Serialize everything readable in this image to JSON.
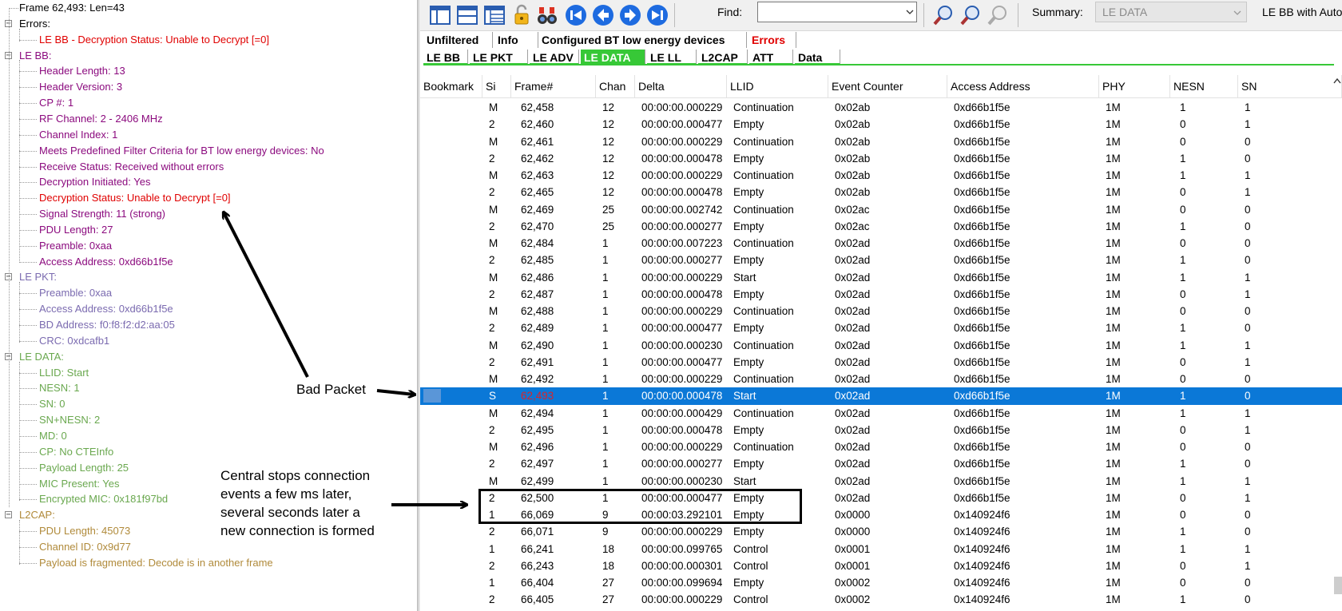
{
  "tree": {
    "rows": [
      {
        "text": "Frame 62,493:  Len=43",
        "color": "black",
        "indent": 0,
        "expander": "none"
      },
      {
        "text": "Errors:",
        "color": "black",
        "indent": 0,
        "expander": "minus"
      },
      {
        "text": "LE BB - Decryption Status: Unable to Decrypt [=0]",
        "color": "err",
        "indent": 1,
        "expander": "none"
      },
      {
        "text": "LE BB:",
        "color": "purple",
        "indent": 0,
        "expander": "minus"
      },
      {
        "text": "Header Length: 13",
        "color": "purple",
        "indent": 1,
        "expander": "none"
      },
      {
        "text": "Header Version: 3",
        "color": "purple",
        "indent": 1,
        "expander": "none"
      },
      {
        "text": "CP #: 1",
        "color": "purple",
        "indent": 1,
        "expander": "none"
      },
      {
        "text": "RF Channel:  2 - 2406 MHz",
        "color": "purple",
        "indent": 1,
        "expander": "none"
      },
      {
        "text": "Channel Index:  1",
        "color": "purple",
        "indent": 1,
        "expander": "none"
      },
      {
        "text": "Meets Predefined Filter Criteria for BT low energy devices: No",
        "color": "purple",
        "indent": 1,
        "expander": "none"
      },
      {
        "text": "Receive Status: Received without errors",
        "color": "purple",
        "indent": 1,
        "expander": "none"
      },
      {
        "text": "Decryption Initiated: Yes",
        "color": "purple",
        "indent": 1,
        "expander": "none"
      },
      {
        "text": "Decryption Status: Unable to Decrypt [=0]",
        "color": "err",
        "indent": 1,
        "expander": "none"
      },
      {
        "text": "Signal Strength: 11 (strong)",
        "color": "purple",
        "indent": 1,
        "expander": "none"
      },
      {
        "text": "PDU Length: 27",
        "color": "purple",
        "indent": 1,
        "expander": "none"
      },
      {
        "text": "Preamble: 0xaa",
        "color": "purple",
        "indent": 1,
        "expander": "none"
      },
      {
        "text": "Access Address: 0xd66b1f5e",
        "color": "purple",
        "indent": 1,
        "expander": "none"
      },
      {
        "text": "LE PKT:",
        "color": "blue",
        "indent": 0,
        "expander": "minus"
      },
      {
        "text": "Preamble: 0xaa",
        "color": "blue",
        "indent": 1,
        "expander": "none"
      },
      {
        "text": "Access Address: 0xd66b1f5e",
        "color": "blue",
        "indent": 1,
        "expander": "none"
      },
      {
        "text": "BD Address: f0:f8:f2:d2:aa:05",
        "color": "blue",
        "indent": 1,
        "expander": "none"
      },
      {
        "text": "CRC: 0xdcafb1",
        "color": "blue",
        "indent": 1,
        "expander": "none"
      },
      {
        "text": "LE DATA:",
        "color": "green",
        "indent": 0,
        "expander": "minus"
      },
      {
        "text": "LLID: Start",
        "color": "green",
        "indent": 1,
        "expander": "none"
      },
      {
        "text": "NESN: 1",
        "color": "green",
        "indent": 1,
        "expander": "none"
      },
      {
        "text": "SN: 0",
        "color": "green",
        "indent": 1,
        "expander": "none"
      },
      {
        "text": "SN+NESN: 2",
        "color": "green",
        "indent": 1,
        "expander": "none"
      },
      {
        "text": "MD: 0",
        "color": "green",
        "indent": 1,
        "expander": "none"
      },
      {
        "text": "CP: No CTEInfo",
        "color": "green",
        "indent": 1,
        "expander": "none"
      },
      {
        "text": "Payload Length: 25",
        "color": "green",
        "indent": 1,
        "expander": "none"
      },
      {
        "text": "MIC Present: Yes",
        "color": "green",
        "indent": 1,
        "expander": "none"
      },
      {
        "text": "Encrypted MIC: 0x181f97bd",
        "color": "green",
        "indent": 1,
        "expander": "none"
      },
      {
        "text": "L2CAP:",
        "color": "brown",
        "indent": 0,
        "expander": "minus"
      },
      {
        "text": "PDU Length: 45073",
        "color": "brown",
        "indent": 1,
        "expander": "none"
      },
      {
        "text": "Channel ID: 0x9d77",
        "color": "brown",
        "indent": 1,
        "expander": "none"
      },
      {
        "text": "Payload is fragmented: Decode is in another frame",
        "color": "brown",
        "indent": 1,
        "expander": "none"
      }
    ]
  },
  "colors": {
    "err": "#e00000",
    "purple": "#8b0a7e",
    "blue": "#7b6bb0",
    "green": "#6aa84f",
    "brown": "#b08a3a",
    "black": "#000000",
    "tab_active": "#37c837",
    "selection": "#0b78d7"
  },
  "toolbar": {
    "find_label": "Find:",
    "find_value": "",
    "summary_label": "Summary:",
    "summary_value": "LE DATA",
    "summary_right": "LE BB with Auto",
    "icons": [
      "pane-layout-1-icon",
      "pane-layout-2-icon",
      "pane-layout-3-icon",
      "unlock-icon",
      "binoculars-icon",
      "first-frame-icon",
      "previous-frame-icon",
      "next-frame-icon",
      "last-frame-icon",
      "find-previous-icon",
      "find-next-icon",
      "find-clear-icon"
    ]
  },
  "tabs_row1": [
    {
      "label": "Unfiltered",
      "color": "black"
    },
    {
      "label": "Info",
      "color": "black"
    },
    {
      "label": "Configured BT low energy devices",
      "color": "black"
    },
    {
      "label": "Errors",
      "color": "err"
    }
  ],
  "tabs_row2": [
    {
      "label": "LE BB",
      "selected": false
    },
    {
      "label": "LE PKT",
      "selected": false
    },
    {
      "label": "LE ADV",
      "selected": false
    },
    {
      "label": "LE DATA",
      "selected": true
    },
    {
      "label": "LE LL",
      "selected": false
    },
    {
      "label": "L2CAP",
      "selected": false
    },
    {
      "label": "ATT",
      "selected": false
    },
    {
      "label": "Data",
      "selected": false
    }
  ],
  "table": {
    "columns": [
      "Bookmark",
      "Si",
      "Frame#",
      "Chan",
      "Delta",
      "LLID",
      "Event Counter",
      "Access Address",
      "PHY",
      "NESN",
      "SN"
    ],
    "rows": [
      [
        "",
        "M",
        "62,458",
        "12",
        "00:00:00.000229",
        "Continuation",
        "0x02ab",
        "0xd66b1f5e",
        "1M",
        "1",
        "1"
      ],
      [
        "",
        "2",
        "62,460",
        "12",
        "00:00:00.000477",
        "Empty",
        "0x02ab",
        "0xd66b1f5e",
        "1M",
        "0",
        "1"
      ],
      [
        "",
        "M",
        "62,461",
        "12",
        "00:00:00.000229",
        "Continuation",
        "0x02ab",
        "0xd66b1f5e",
        "1M",
        "0",
        "0"
      ],
      [
        "",
        "2",
        "62,462",
        "12",
        "00:00:00.000478",
        "Empty",
        "0x02ab",
        "0xd66b1f5e",
        "1M",
        "1",
        "0"
      ],
      [
        "",
        "M",
        "62,463",
        "12",
        "00:00:00.000229",
        "Continuation",
        "0x02ab",
        "0xd66b1f5e",
        "1M",
        "1",
        "1"
      ],
      [
        "",
        "2",
        "62,465",
        "12",
        "00:00:00.000478",
        "Empty",
        "0x02ab",
        "0xd66b1f5e",
        "1M",
        "0",
        "1"
      ],
      [
        "",
        "M",
        "62,469",
        "25",
        "00:00:00.002742",
        "Continuation",
        "0x02ac",
        "0xd66b1f5e",
        "1M",
        "0",
        "0"
      ],
      [
        "",
        "2",
        "62,470",
        "25",
        "00:00:00.000277",
        "Empty",
        "0x02ac",
        "0xd66b1f5e",
        "1M",
        "1",
        "0"
      ],
      [
        "",
        "M",
        "62,484",
        "1",
        "00:00:00.007223",
        "Continuation",
        "0x02ad",
        "0xd66b1f5e",
        "1M",
        "0",
        "0"
      ],
      [
        "",
        "2",
        "62,485",
        "1",
        "00:00:00.000277",
        "Empty",
        "0x02ad",
        "0xd66b1f5e",
        "1M",
        "1",
        "0"
      ],
      [
        "",
        "M",
        "62,486",
        "1",
        "00:00:00.000229",
        "Start",
        "0x02ad",
        "0xd66b1f5e",
        "1M",
        "1",
        "1"
      ],
      [
        "",
        "2",
        "62,487",
        "1",
        "00:00:00.000478",
        "Empty",
        "0x02ad",
        "0xd66b1f5e",
        "1M",
        "0",
        "1"
      ],
      [
        "",
        "M",
        "62,488",
        "1",
        "00:00:00.000229",
        "Continuation",
        "0x02ad",
        "0xd66b1f5e",
        "1M",
        "0",
        "0"
      ],
      [
        "",
        "2",
        "62,489",
        "1",
        "00:00:00.000477",
        "Empty",
        "0x02ad",
        "0xd66b1f5e",
        "1M",
        "1",
        "0"
      ],
      [
        "",
        "M",
        "62,490",
        "1",
        "00:00:00.000230",
        "Continuation",
        "0x02ad",
        "0xd66b1f5e",
        "1M",
        "1",
        "1"
      ],
      [
        "",
        "2",
        "62,491",
        "1",
        "00:00:00.000477",
        "Empty",
        "0x02ad",
        "0xd66b1f5e",
        "1M",
        "0",
        "1"
      ],
      [
        "",
        "M",
        "62,492",
        "1",
        "00:00:00.000229",
        "Continuation",
        "0x02ad",
        "0xd66b1f5e",
        "1M",
        "0",
        "0"
      ],
      [
        "",
        "S",
        "62,493",
        "1",
        "00:00:00.000478",
        "Start",
        "0x02ad",
        "0xd66b1f5e",
        "1M",
        "1",
        "0"
      ],
      [
        "",
        "M",
        "62,494",
        "1",
        "00:00:00.000429",
        "Continuation",
        "0x02ad",
        "0xd66b1f5e",
        "1M",
        "1",
        "1"
      ],
      [
        "",
        "2",
        "62,495",
        "1",
        "00:00:00.000478",
        "Empty",
        "0x02ad",
        "0xd66b1f5e",
        "1M",
        "0",
        "1"
      ],
      [
        "",
        "M",
        "62,496",
        "1",
        "00:00:00.000229",
        "Continuation",
        "0x02ad",
        "0xd66b1f5e",
        "1M",
        "0",
        "0"
      ],
      [
        "",
        "2",
        "62,497",
        "1",
        "00:00:00.000277",
        "Empty",
        "0x02ad",
        "0xd66b1f5e",
        "1M",
        "1",
        "0"
      ],
      [
        "",
        "M",
        "62,499",
        "1",
        "00:00:00.000230",
        "Start",
        "0x02ad",
        "0xd66b1f5e",
        "1M",
        "1",
        "1"
      ],
      [
        "",
        "2",
        "62,500",
        "1",
        "00:00:00.000477",
        "Empty",
        "0x02ad",
        "0xd66b1f5e",
        "1M",
        "0",
        "1"
      ],
      [
        "",
        "1",
        "66,069",
        "9",
        "00:00:03.292101",
        "Empty",
        "0x0000",
        "0x140924f6",
        "1M",
        "0",
        "0"
      ],
      [
        "",
        "2",
        "66,071",
        "9",
        "00:00:00.000229",
        "Empty",
        "0x0000",
        "0x140924f6",
        "1M",
        "1",
        "0"
      ],
      [
        "",
        "1",
        "66,241",
        "18",
        "00:00:00.099765",
        "Control",
        "0x0001",
        "0x140924f6",
        "1M",
        "1",
        "1"
      ],
      [
        "",
        "2",
        "66,243",
        "18",
        "00:00:00.000301",
        "Control",
        "0x0001",
        "0x140924f6",
        "1M",
        "0",
        "1"
      ],
      [
        "",
        "1",
        "66,404",
        "27",
        "00:00:00.099694",
        "Empty",
        "0x0002",
        "0x140924f6",
        "1M",
        "0",
        "0"
      ],
      [
        "",
        "2",
        "66,405",
        "27",
        "00:00:00.000229",
        "Control",
        "0x0002",
        "0x140924f6",
        "1M",
        "1",
        "0"
      ]
    ],
    "selected_row": 17
  },
  "annotations": {
    "bad_packet": "Bad Packet",
    "central_lines": [
      "Central stops connection",
      "events a few ms later,",
      "several seconds later a",
      "new connection is formed"
    ]
  }
}
